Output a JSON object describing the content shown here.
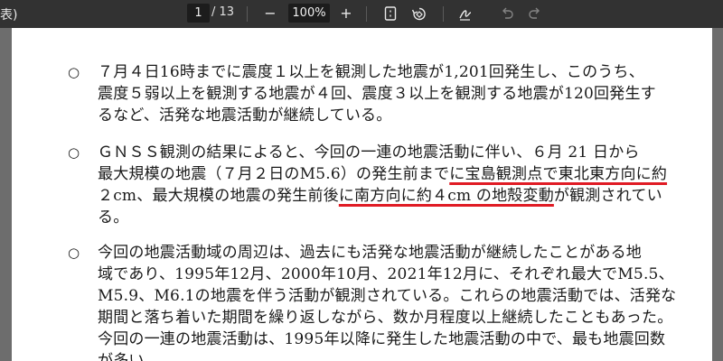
{
  "toolbar": {
    "title": "表)",
    "page_current": "1",
    "page_total": "/ 13",
    "zoom_out": "−",
    "zoom_value": "100%",
    "zoom_in": "+",
    "icons": [
      "fit-page-icon",
      "rotate-icon",
      "draw-icon",
      "undo-icon",
      "redo-icon"
    ]
  },
  "document": {
    "paragraphs": [
      {
        "bullet": "○",
        "lines": [
          "７月４日16時までに震度１以上を観測した地震が1,201回発生し、このうち、",
          "震度５弱以上を観測する地震が４回、震度３以上を観測する地震が120回発生す",
          "るなど、活発な地震活動が継続している。"
        ]
      },
      {
        "bullet": "○",
        "line1": "ＧＮＳＳ観測の結果によると、今回の一連の地震活動に伴い、６月 21 日から",
        "line2_pre": "最大規模の地震（７月２日のM5.6）の発生前まで",
        "line2_underlined": "に宝島観測点で東北東方向に約",
        "line3_pre": "２cm、最大規模の地震の発生前後",
        "line3_underlined": "に南方向に約４cm の地殻変動",
        "line3_post": "が観測されてい",
        "line4": "る。"
      },
      {
        "bullet": "○",
        "lines": [
          "今回の地震活動域の周辺は、過去にも活発な地震活動が継続したことがある地",
          "域であり、1995年12月、2000年10月、2021年12月に、それぞれ最大でM5.5、",
          "M5.9、M6.1の地震を伴う活動が観測されている。これらの地震活動では、活発な",
          "期間と落ち着いた期間を繰り返しながら、数か月程度以上継続したこともあった。",
          "今回の一連の地震活動は、1995年以降に発生した地震活動の中で、最も地震回数",
          "が多い。"
        ]
      }
    ]
  },
  "colors": {
    "toolbar_bg": "#323232",
    "page_bg": "#ffffff",
    "underline": "#e01b24"
  }
}
